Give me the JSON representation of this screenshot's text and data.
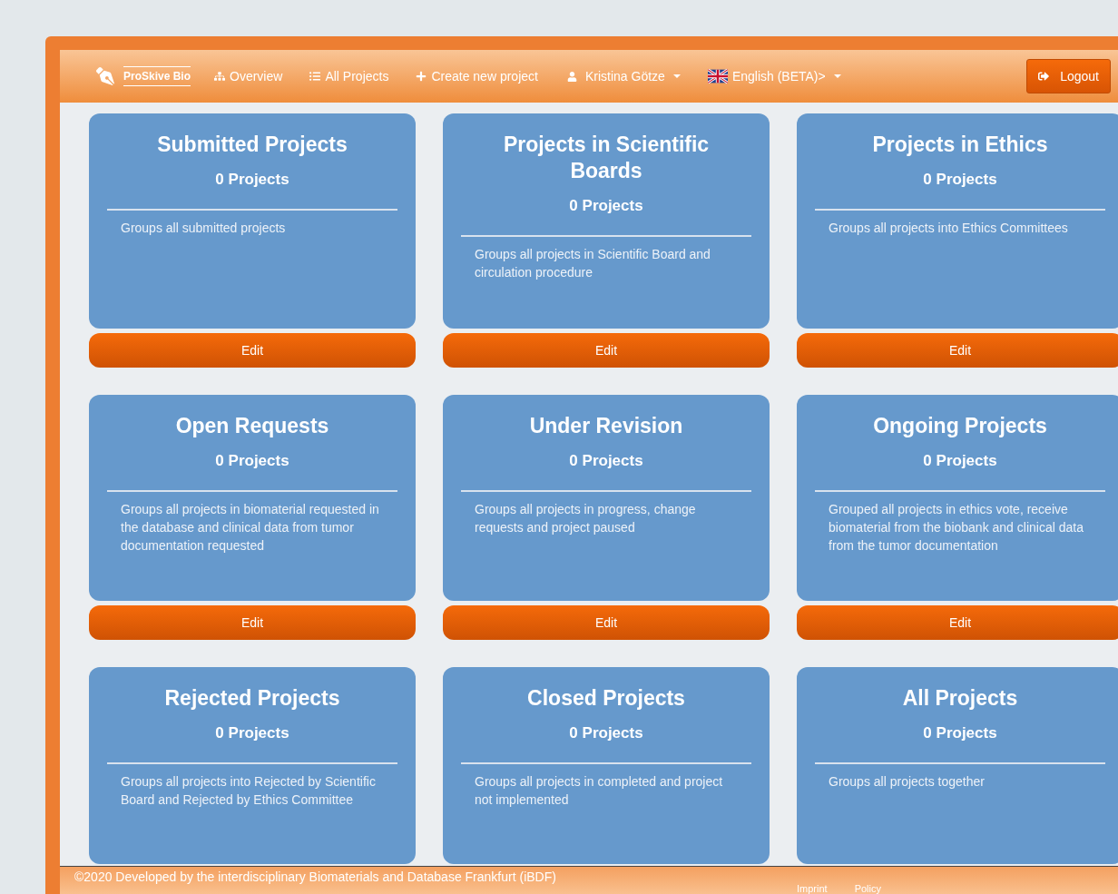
{
  "navbar": {
    "brand": "ProSkive Bio",
    "links": [
      {
        "kind": "overview",
        "label": "Overview"
      },
      {
        "kind": "list",
        "label": "All Projects"
      },
      {
        "kind": "create",
        "label": "Create new project"
      }
    ],
    "user": {
      "label": "Kristina Götze"
    },
    "language": {
      "label": "English (BETA)>"
    },
    "logout": {
      "label": "Logout"
    }
  },
  "cards": [
    {
      "title": "Submitted Projects",
      "count": "0 Projects",
      "description": "Groups all submitted projects",
      "edit": "Edit"
    },
    {
      "title": "Projects in Scientific Boards",
      "count": "0 Projects",
      "description": "Groups all projects in Scientific Board and circulation procedure",
      "edit": "Edit"
    },
    {
      "title": "Projects in Ethics",
      "count": "0 Projects",
      "description": "Groups all projects into Ethics Committees",
      "edit": "Edit"
    },
    {
      "title": "Open Requests",
      "count": "0 Projects",
      "description": "Groups all projects in biomaterial requested in the database and clinical data from tumor documentation requested",
      "edit": "Edit"
    },
    {
      "title": "Under Revision",
      "count": "0 Projects",
      "description": "Groups all projects in progress, change requests and project paused",
      "edit": "Edit"
    },
    {
      "title": "Ongoing Projects",
      "count": "0 Projects",
      "description": "Grouped all projects in ethics vote, receive biomaterial from the biobank and clinical data from the tumor documentation",
      "edit": "Edit"
    },
    {
      "title": "Rejected Projects",
      "count": "0 Projects",
      "description": "Groups all projects into Rejected by Scientific Board and Rejected by Ethics Committee"
    },
    {
      "title": "Closed Projects",
      "count": "0 Projects",
      "description": "Groups all projects in completed and project not implemented"
    },
    {
      "title": "All Projects",
      "count": "0 Projects",
      "description": "Groups all projects together"
    }
  ],
  "footer": {
    "copyright": "©2020 Developed by the interdisciplinary Biomaterials and Database Frankfurt (iBDF)",
    "links": [
      "Imprint",
      "Policy"
    ]
  }
}
